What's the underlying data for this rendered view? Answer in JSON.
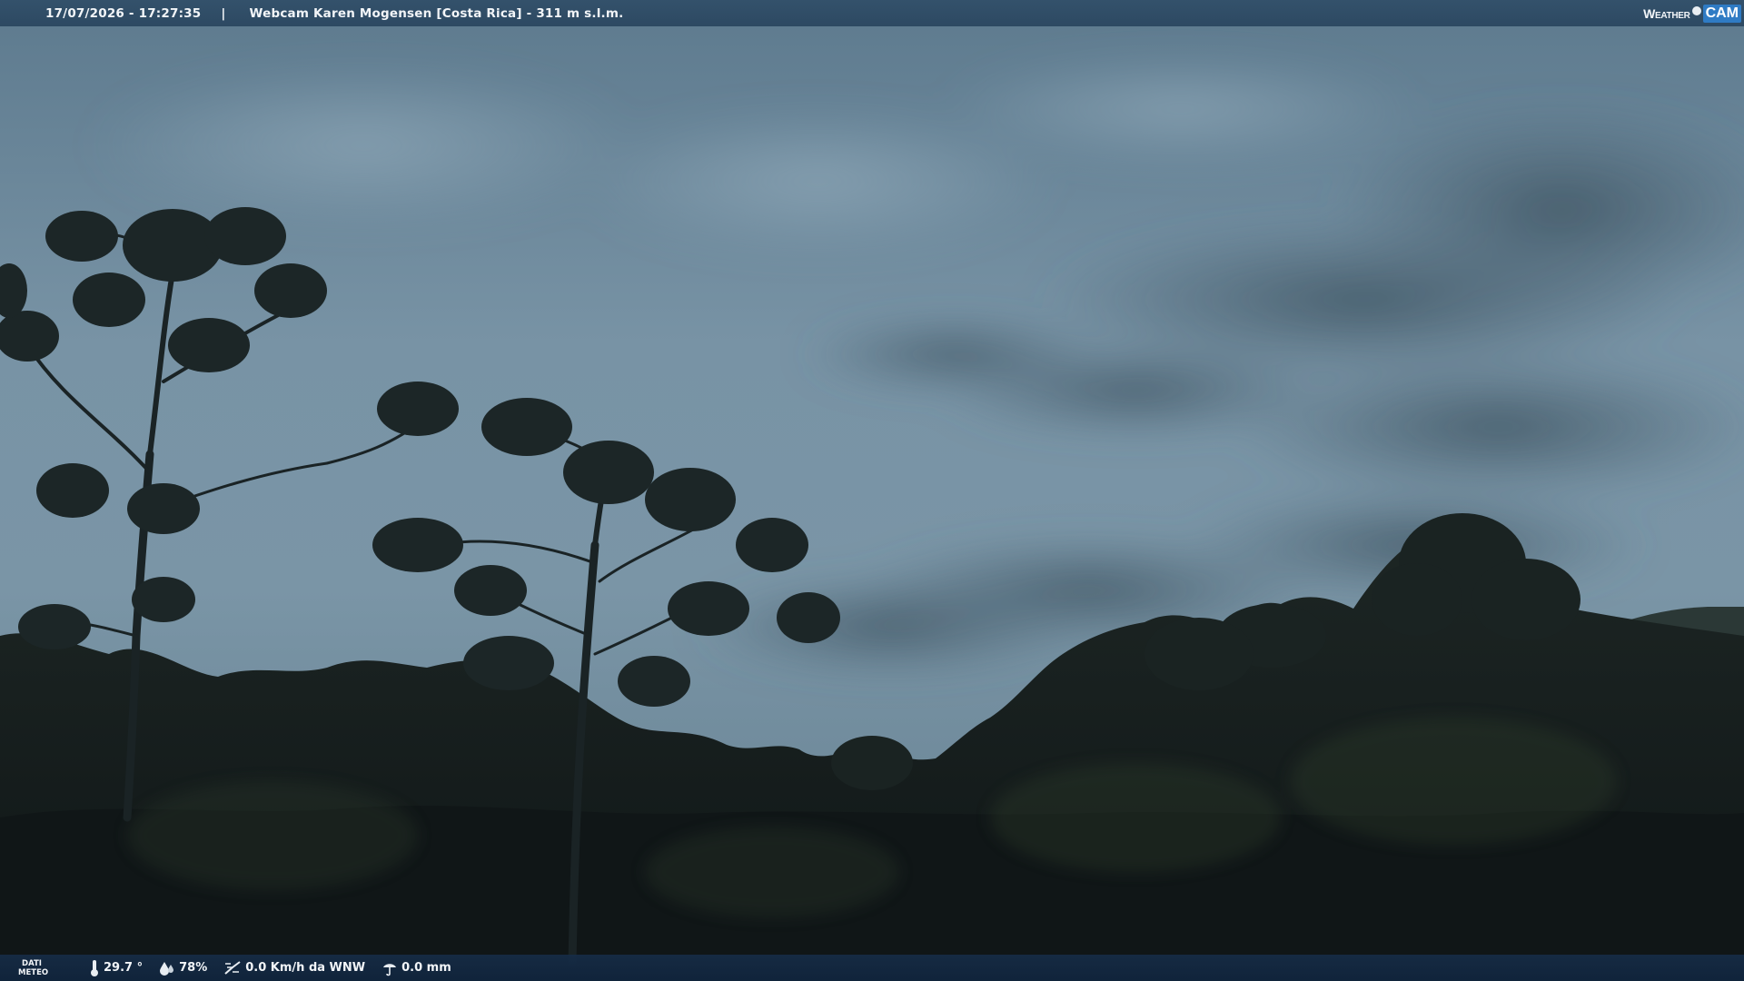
{
  "header": {
    "timestamp": "17/07/2026 - 17:27:35",
    "separator": "|",
    "title": "Webcam Karen Mogensen [Costa Rica] - 311 m s.l.m."
  },
  "brand": {
    "weather": "Weather",
    "cam": "CAM"
  },
  "footer": {
    "label_line1": "DATI",
    "label_line2": "METEO",
    "temperature": "29.7 °",
    "humidity": "78%",
    "wind": "0.0 Km/h da WNW",
    "rain": "0.0 mm"
  },
  "icons": {
    "temperature": "thermometer-icon",
    "humidity": "humidity-icon",
    "wind": "wind-icon",
    "rain": "rain-icon"
  },
  "colors": {
    "sky_top": "#5d7a8e",
    "sky_mid": "#7f9aab",
    "forest": "#141b1c",
    "bar": "#2a4a6a",
    "brand_blue": "#2f7bc4"
  }
}
